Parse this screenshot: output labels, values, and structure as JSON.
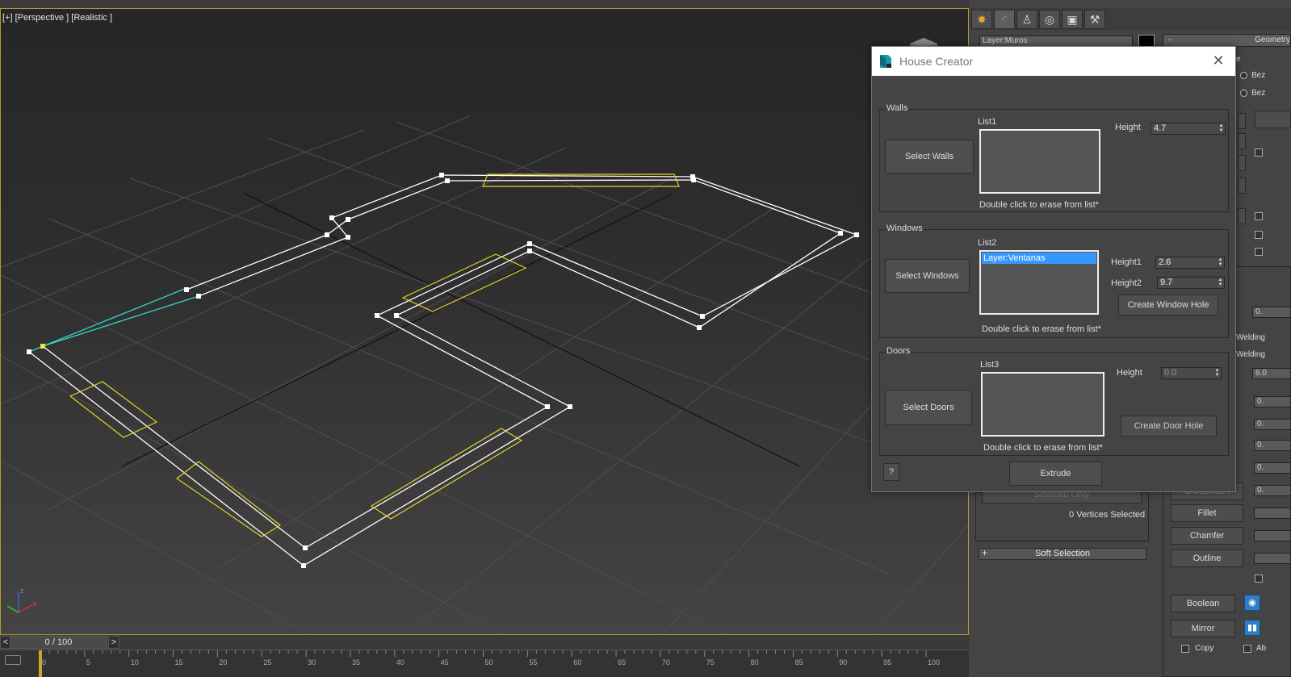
{
  "viewport": {
    "label": "[+] [Perspective ] [Realistic ]",
    "axis_x": "x",
    "axis_z": "z"
  },
  "timeline": {
    "prev": "<",
    "next": ">",
    "frame": "0 / 100",
    "ruler_ticks": [
      "0",
      "5",
      "10",
      "15",
      "20",
      "25",
      "30",
      "35",
      "40",
      "45",
      "50",
      "55",
      "60",
      "65",
      "70",
      "75",
      "80",
      "85",
      "90",
      "95",
      "100"
    ]
  },
  "panel": {
    "toolbar_icons": [
      "create-icon",
      "modify-icon",
      "hierarchy-icon",
      "motion-icon",
      "display-icon",
      "utilities-icon"
    ],
    "layer_name": "Layer:Muros",
    "geometry_minus": "-",
    "geometry_label": "Geometry",
    "rollout_suffix": "e",
    "bez1": "Bez",
    "bez2": "Bez",
    "welding1": "Welding",
    "welding2": "Welding",
    "val_1": "0.",
    "val_2": "6.0",
    "val_3": "0.",
    "val_4": "0.",
    "val_5": "0.",
    "val_6": "0.",
    "val_7": "0.",
    "crossinsert": "CrossInsert",
    "selected_only": "Selected Only",
    "vertices_selected": "0 Vertices Selected",
    "soft_selection": "Soft Selection",
    "soft_plus": "+",
    "fillet": "Fillet",
    "chamfer": "Chamfer",
    "outline": "Outline",
    "boolean": "Boolean",
    "mirror": "Mirror",
    "copy": "Copy",
    "ab": "Ab"
  },
  "dialog": {
    "title": "House Creator",
    "close": "✕",
    "walls": {
      "group": "Walls",
      "button": "Select Walls",
      "list_label": "List1",
      "hint": "Double click to erase from list*",
      "height_label": "Height",
      "height_value": "4.7"
    },
    "windows": {
      "group": "Windows",
      "button": "Select Windows",
      "list_label": "List2",
      "items": [
        "Layer:Ventanas"
      ],
      "hint": "Double click to erase from list*",
      "height1_label": "Height1",
      "height1_value": "2.6",
      "height2_label": "Height2",
      "height2_value": "9.7",
      "create_button": "Create Window Hole"
    },
    "doors": {
      "group": "Doors",
      "button": "Select Doors",
      "list_label": "List3",
      "hint": "Double click to erase from list*",
      "height_label": "Height",
      "height_value": "0.0",
      "create_button": "Create Door Hole"
    },
    "help": "?",
    "extrude": "Extrude"
  },
  "colors": {
    "viewport_border": "#b39a2c",
    "wall_outline": "#ffffff",
    "opening_outline": "#e1d22a",
    "selected_segment": "#35d6c4",
    "list_selection": "#3399ff"
  }
}
